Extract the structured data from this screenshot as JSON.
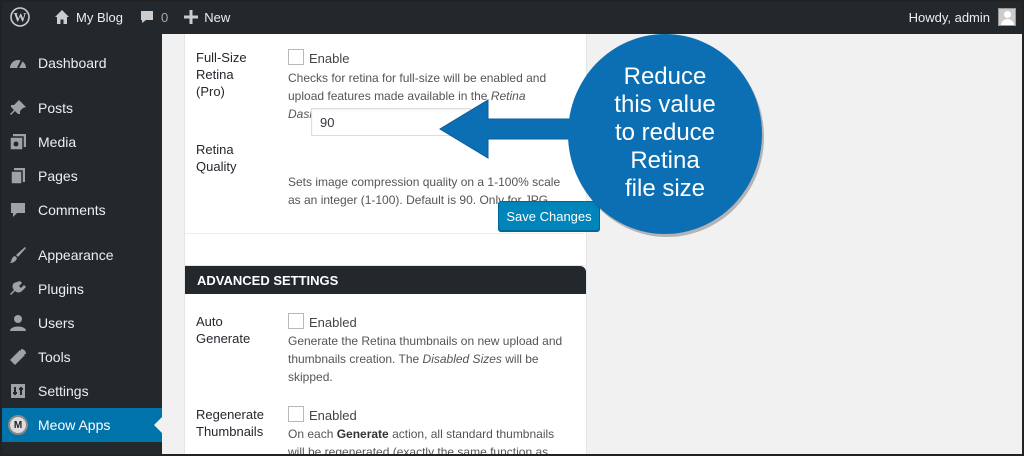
{
  "adminbar": {
    "site_name": "My Blog",
    "comments_count": "0",
    "new_label": "New",
    "howdy": "Howdy, admin"
  },
  "sidebar": {
    "items": [
      {
        "label": "Dashboard",
        "icon": "dashboard-icon"
      },
      {
        "label": "Posts",
        "icon": "pin-icon"
      },
      {
        "label": "Media",
        "icon": "media-icon"
      },
      {
        "label": "Pages",
        "icon": "pages-icon"
      },
      {
        "label": "Comments",
        "icon": "comment-icon"
      },
      {
        "label": "Appearance",
        "icon": "brush-icon"
      },
      {
        "label": "Plugins",
        "icon": "plugin-icon"
      },
      {
        "label": "Users",
        "icon": "user-icon"
      },
      {
        "label": "Tools",
        "icon": "wrench-icon"
      },
      {
        "label": "Settings",
        "icon": "settings-icon"
      },
      {
        "label": "Meow Apps",
        "icon": "meow-logo-icon",
        "badge": "M",
        "active": true
      }
    ]
  },
  "panel1": {
    "fullsize": {
      "label_line1": "Full-Size",
      "label_line2": "Retina",
      "label_line3": "(Pro)",
      "checkbox_label": "Enable",
      "desc_pre": "Checks for retina for full-size will be enabled and upload features made available in the ",
      "desc_em": "Retina Dashboard",
      "desc_post": "."
    },
    "quality": {
      "label_line1": "Retina",
      "label_line2": "Quality",
      "value": "90",
      "desc_line1": "Sets image compression quality on a 1-100% scale",
      "desc_line2": "as an integer (1-100). Default is 90. Only for JPG."
    },
    "save_label": "Save Changes"
  },
  "panel2": {
    "header": "ADVANCED SETTINGS",
    "auto_generate": {
      "label_line1": "Auto",
      "label_line2": "Generate",
      "checkbox_label": "Enabled",
      "desc_pre": "Generate the Retina thumbnails on new upload and thumbnails creation. The ",
      "desc_em": "Disabled Sizes",
      "desc_post": " will be skipped."
    },
    "regenerate": {
      "label_line1": "Regenerate",
      "label_line2": "Thumbnails",
      "checkbox_label": "Enabled",
      "desc_pre": "On each ",
      "desc_strong": "Generate",
      "desc_post": " action, all standard thumbnails will be regenerated (exactly the same function as"
    }
  },
  "callout": {
    "lines": [
      "Reduce",
      "this value",
      "to reduce",
      "Retina",
      "file size"
    ],
    "color": "#0d6fb3"
  }
}
